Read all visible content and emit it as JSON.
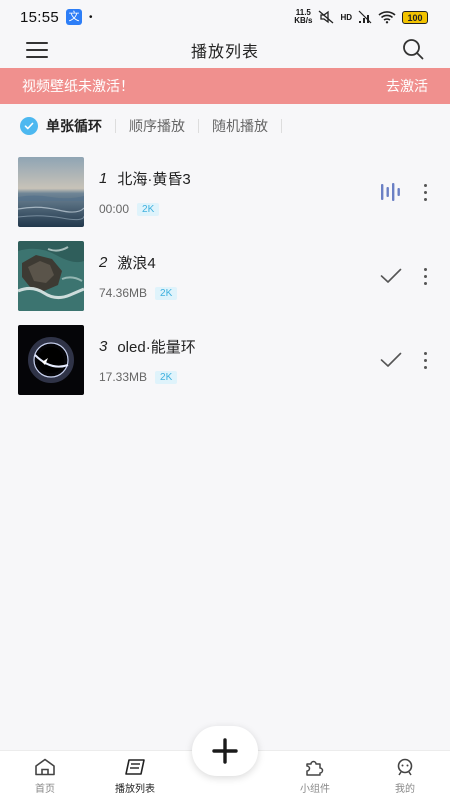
{
  "status_bar": {
    "time": "15:55",
    "net_speed_top": "11.5",
    "net_speed_bottom": "KB/s",
    "hd": "HD",
    "battery": "100"
  },
  "header": {
    "title": "播放列表"
  },
  "banner": {
    "message": "视频壁纸未激活！",
    "action": "去激活",
    "color": "#f0908e"
  },
  "play_modes": [
    {
      "label": "单张循环",
      "active": true
    },
    {
      "label": "顺序播放",
      "active": false
    },
    {
      "label": "随机播放",
      "active": false
    }
  ],
  "playlist": [
    {
      "index": "1",
      "title": "北海·黄昏3",
      "info": "00:00",
      "quality": "2K",
      "state": "playing"
    },
    {
      "index": "2",
      "title": "激浪4",
      "info": "74.36MB",
      "quality": "2K",
      "state": "downloaded"
    },
    {
      "index": "3",
      "title": "oled·能量环",
      "info": "17.33MB",
      "quality": "2K",
      "state": "downloaded"
    }
  ],
  "bottom_nav": [
    {
      "label": "首页",
      "icon": "home-icon",
      "active": false
    },
    {
      "label": "播放列表",
      "icon": "playlist-icon",
      "active": true
    },
    {
      "label": "小组件",
      "icon": "puzzle-icon",
      "active": false
    },
    {
      "label": "我的",
      "icon": "profile-icon",
      "active": false
    }
  ],
  "fab": {
    "icon": "plus-icon"
  },
  "colors": {
    "accent": "#4db8f0",
    "banner": "#f0908e",
    "badge_text": "#3fb0de",
    "playing_bars": "#6a7fc4"
  }
}
